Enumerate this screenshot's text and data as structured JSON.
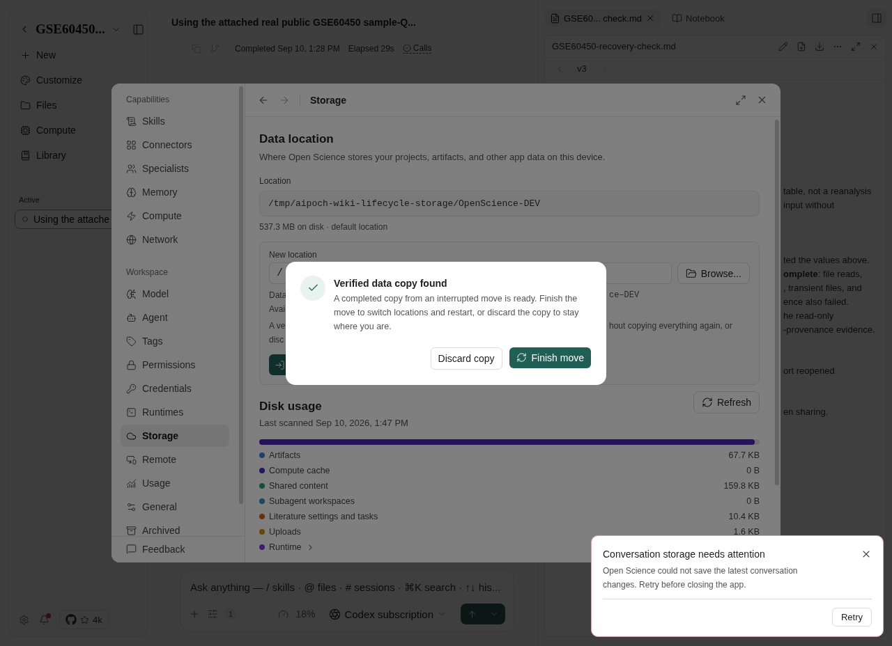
{
  "sidebar": {
    "project_title": "GSE60450...",
    "nav": [
      {
        "label": "New"
      },
      {
        "label": "Customize"
      },
      {
        "label": "Files"
      },
      {
        "label": "Compute"
      },
      {
        "label": "Library"
      }
    ],
    "active_heading": "Active",
    "sessions": [
      {
        "label": "Using the attache",
        "selected": true
      }
    ],
    "notifications_unread": true,
    "github_stars": "4k"
  },
  "conversation": {
    "title": "Using the attached real public GSE60450 sample-Q...",
    "completed": "Completed Sep 10, 1:28 PM",
    "elapsed": "Elapsed 29s",
    "calls": "Calls"
  },
  "composer": {
    "placeholder": "Ask anything — / skills · @ files · # sessions · ⌘K search · ↑↓ his...",
    "tools_count": "1",
    "context_usage": "18%",
    "model": "Codex subscription"
  },
  "artifact_panel": {
    "tabs": [
      {
        "label": "GSE60... check.md",
        "selected": true,
        "kind": "file"
      },
      {
        "label": "Notebook",
        "selected": false,
        "kind": "notebook"
      }
    ],
    "file_name": "GSE60450-recovery-check.md",
    "version": "v3",
    "paragraphs": [
      [
        "table, not a reanalysis",
        "input without"
      ],
      [
        "ted the values above.",
        "**omplete**: file reads,",
        ", transient files, and",
        "ence also failed.",
        "he read-only",
        "-provenance evidence."
      ],
      [
        "ort reopened"
      ],
      [
        "en sharing."
      ]
    ]
  },
  "settings": {
    "nav_sections": [
      {
        "heading": "Capabilities",
        "items": [
          {
            "label": "Skills",
            "selected": false
          },
          {
            "label": "Connectors",
            "selected": false
          },
          {
            "label": "Specialists",
            "selected": false
          },
          {
            "label": "Memory",
            "selected": false
          },
          {
            "label": "Compute",
            "selected": false
          },
          {
            "label": "Network",
            "selected": false
          }
        ]
      },
      {
        "heading": "Workspace",
        "items": [
          {
            "label": "Model",
            "selected": false
          },
          {
            "label": "Agent",
            "selected": false
          },
          {
            "label": "Tags",
            "selected": false
          },
          {
            "label": "Permissions",
            "selected": false
          },
          {
            "label": "Credentials",
            "selected": false
          },
          {
            "label": "Runtimes",
            "selected": false
          },
          {
            "label": "Storage",
            "selected": true
          },
          {
            "label": "Remote",
            "selected": false
          },
          {
            "label": "Usage",
            "selected": false
          },
          {
            "label": "General",
            "selected": false
          },
          {
            "label": "Archived",
            "selected": false
          }
        ]
      }
    ],
    "footer_item": "Feedback",
    "page_title": "Storage",
    "data_location": {
      "heading": "Data location",
      "description": "Where Open Science stores your projects, artifacts, and other app data on this device.",
      "location_label": "Location",
      "location_value": "/tmp/aipoch-wiki-lifecycle-storage/OpenScience-DEV",
      "location_note": "537.3 MB on disk · default location",
      "new_location": {
        "label": "New location",
        "input_value": "/",
        "browse": "Browse...",
        "lines": [
          {
            "left": "Data",
            "right": "ce–DEV",
            "kind": "path"
          },
          {
            "left": "Avai"
          },
          {
            "left": "A ve",
            "right": "hout copying everything again, or",
            "kind": "text"
          },
          {
            "left": "disc"
          }
        ]
      }
    },
    "disk_usage": {
      "heading": "Disk usage",
      "last_scanned": "Last scanned Sep 10, 2026, 1:47 PM",
      "refresh": "Refresh",
      "level": 0.99,
      "items": [
        {
          "label": "Artifacts",
          "value": "67.7 KB",
          "color": "#1e406b"
        },
        {
          "label": "Compute cache",
          "value": "0 B",
          "color": "#251665"
        },
        {
          "label": "Shared content",
          "value": "159.8 KB",
          "color": "#154d3e"
        },
        {
          "label": "Subagent workspaces",
          "value": "0 B",
          "color": "#184a5b"
        },
        {
          "label": "Literature settings and tasks",
          "value": "10.4 KB",
          "color": "#693008"
        },
        {
          "label": "Uploads",
          "value": "1.6 KB",
          "color": "#684708"
        },
        {
          "label": "Runtime",
          "color": "#3e1d73",
          "expandable": true
        }
      ]
    }
  },
  "dialog": {
    "title": "Verified data copy found",
    "body": "A completed copy from an interrupted move is ready. Finish the move to switch locations and restart, or discard the copy to stay where you are.",
    "discard": "Discard copy",
    "confirm": "Finish move"
  },
  "toast": {
    "title": "Conversation storage needs attention",
    "body": "Open Science could not save the latest conversation changes. Retry before closing the app.",
    "action": "Retry"
  }
}
